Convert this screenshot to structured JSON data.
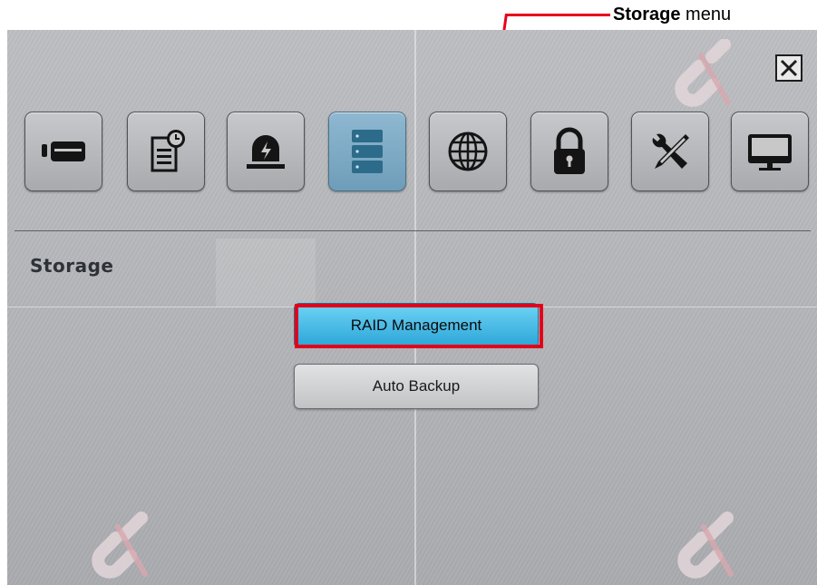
{
  "callout": {
    "bold": "Storage",
    "text": "menu",
    "color": "#e8001c"
  },
  "window": {
    "close_icon": "close-icon"
  },
  "toolbar": {
    "items": [
      {
        "name": "camera-device-icon",
        "active": false
      },
      {
        "name": "schedule-record-icon",
        "active": false
      },
      {
        "name": "event-alarm-icon",
        "active": false
      },
      {
        "name": "storage-icon",
        "active": true
      },
      {
        "name": "network-globe-icon",
        "active": false
      },
      {
        "name": "security-lock-icon",
        "active": false
      },
      {
        "name": "system-tools-icon",
        "active": false
      },
      {
        "name": "display-monitor-icon",
        "active": false
      }
    ],
    "active_color": "#7eaac4"
  },
  "section": {
    "title": "Storage"
  },
  "menu": {
    "raid_label": "RAID Management",
    "backup_label": "Auto Backup",
    "selected_color": "#2aa5d8",
    "highlight_color": "#e3001b"
  }
}
